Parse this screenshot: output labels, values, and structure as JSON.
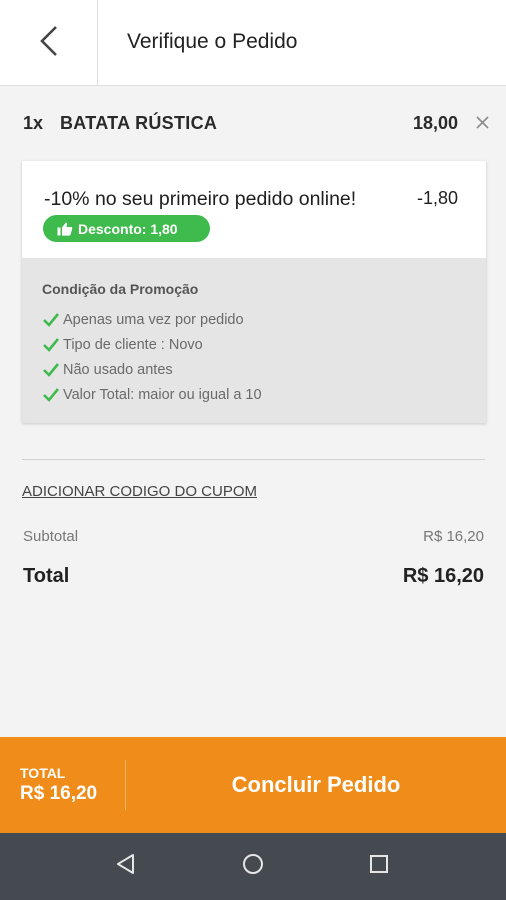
{
  "header": {
    "back_icon": "chevron-left-icon",
    "title": "Verifique o Pedido"
  },
  "order": {
    "items": [
      {
        "qty": "1x",
        "name": "BATATA RÚSTICA",
        "price": "18,00",
        "remove_icon": "close-icon"
      }
    ]
  },
  "promo": {
    "title": "-10% no seu primeiro pedido online!",
    "amount": "-1,80",
    "badge_icon": "thumbs-up-icon",
    "badge_text": "Desconto: 1,80",
    "conditions_title": "Condição da Promoção",
    "conditions": [
      "Apenas uma vez por pedido",
      "Tipo de cliente : Novo",
      "Não usado antes",
      "Valor Total: maior ou igual a 10"
    ]
  },
  "coupon": {
    "link_label": "ADICIONAR CODIGO DO CUPOM"
  },
  "summary": {
    "subtotal_label": "Subtotal",
    "subtotal_value": "R$ 16,20",
    "total_label": "Total",
    "total_value": "R$ 16,20"
  },
  "checkout": {
    "total_label": "TOTAL",
    "total_value": "R$ 16,20",
    "button_label": "Concluir Pedido"
  },
  "nav": {
    "back_icon": "triangle-back-icon",
    "home_icon": "circle-home-icon",
    "recents_icon": "square-recents-icon"
  },
  "colors": {
    "accent": "#f08c1a",
    "badge_green": "#3fba4c",
    "check_green": "#3fba4c",
    "nav_bg": "#454a50"
  }
}
